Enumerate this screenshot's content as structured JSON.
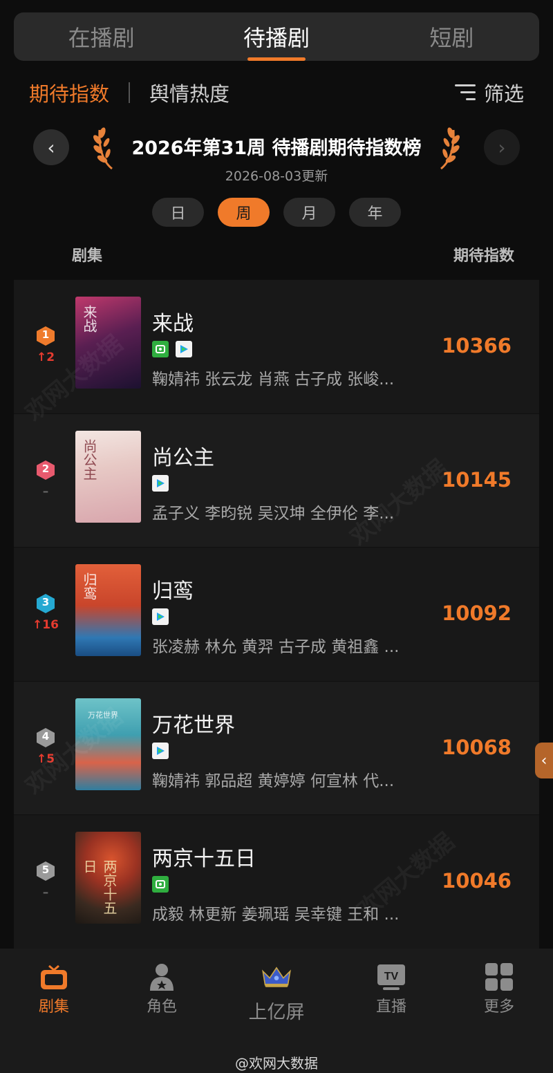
{
  "top_tabs": [
    "在播剧",
    "待播剧",
    "短剧"
  ],
  "subnav": {
    "expect_index": "期待指数",
    "public_opinion": "舆情热度",
    "filter": "筛选"
  },
  "rank_title": "2026年第31周 待播剧期待指数榜",
  "update_date": "2026-08-03更新",
  "periods": [
    "日",
    "周",
    "月",
    "年"
  ],
  "columns": {
    "series": "剧集",
    "index": "期待指数"
  },
  "colors": {
    "accent": "#f07a2a",
    "rank_up": "#e53b2f"
  },
  "rows": [
    {
      "rank": "1",
      "change": "↑2",
      "title": "来战",
      "poster_text": "来战",
      "platforms": [
        "iqiyi-icon",
        "tencent-video-icon"
      ],
      "cast": "鞠婧祎 张云龙 肖燕 古子成 张峻...",
      "score": "10366"
    },
    {
      "rank": "2",
      "change": "–",
      "title": "尚公主",
      "poster_text": "尚公主",
      "platforms": [
        "tencent-video-icon"
      ],
      "cast": "孟子义 李昀锐 吴汉坤 全伊伦 李...",
      "score": "10145"
    },
    {
      "rank": "3",
      "change": "↑16",
      "title": "归鸾",
      "poster_text": "归鸾",
      "platforms": [
        "tencent-video-icon"
      ],
      "cast": "张凌赫 林允 黄羿 古子成 黄祖鑫 ...",
      "score": "10092"
    },
    {
      "rank": "4",
      "change": "↑5",
      "title": "万花世界",
      "poster_text": "万花世界",
      "platforms": [
        "tencent-video-icon"
      ],
      "cast": "鞠婧祎 郭品超 黄婷婷 何宣林 代...",
      "score": "10068"
    },
    {
      "rank": "5",
      "change": "–",
      "title": "两京十五日",
      "poster_text": "两京十五日",
      "platforms": [
        "iqiyi-icon"
      ],
      "cast": "成毅 林更新 姜珮瑶 吴幸键 王和 ...",
      "score": "10046"
    }
  ],
  "watermark": "欢网大数据",
  "bottom_nav": [
    "剧集",
    "角色",
    "上亿屏",
    "直播",
    "更多"
  ],
  "credit": "@欢网大数据"
}
